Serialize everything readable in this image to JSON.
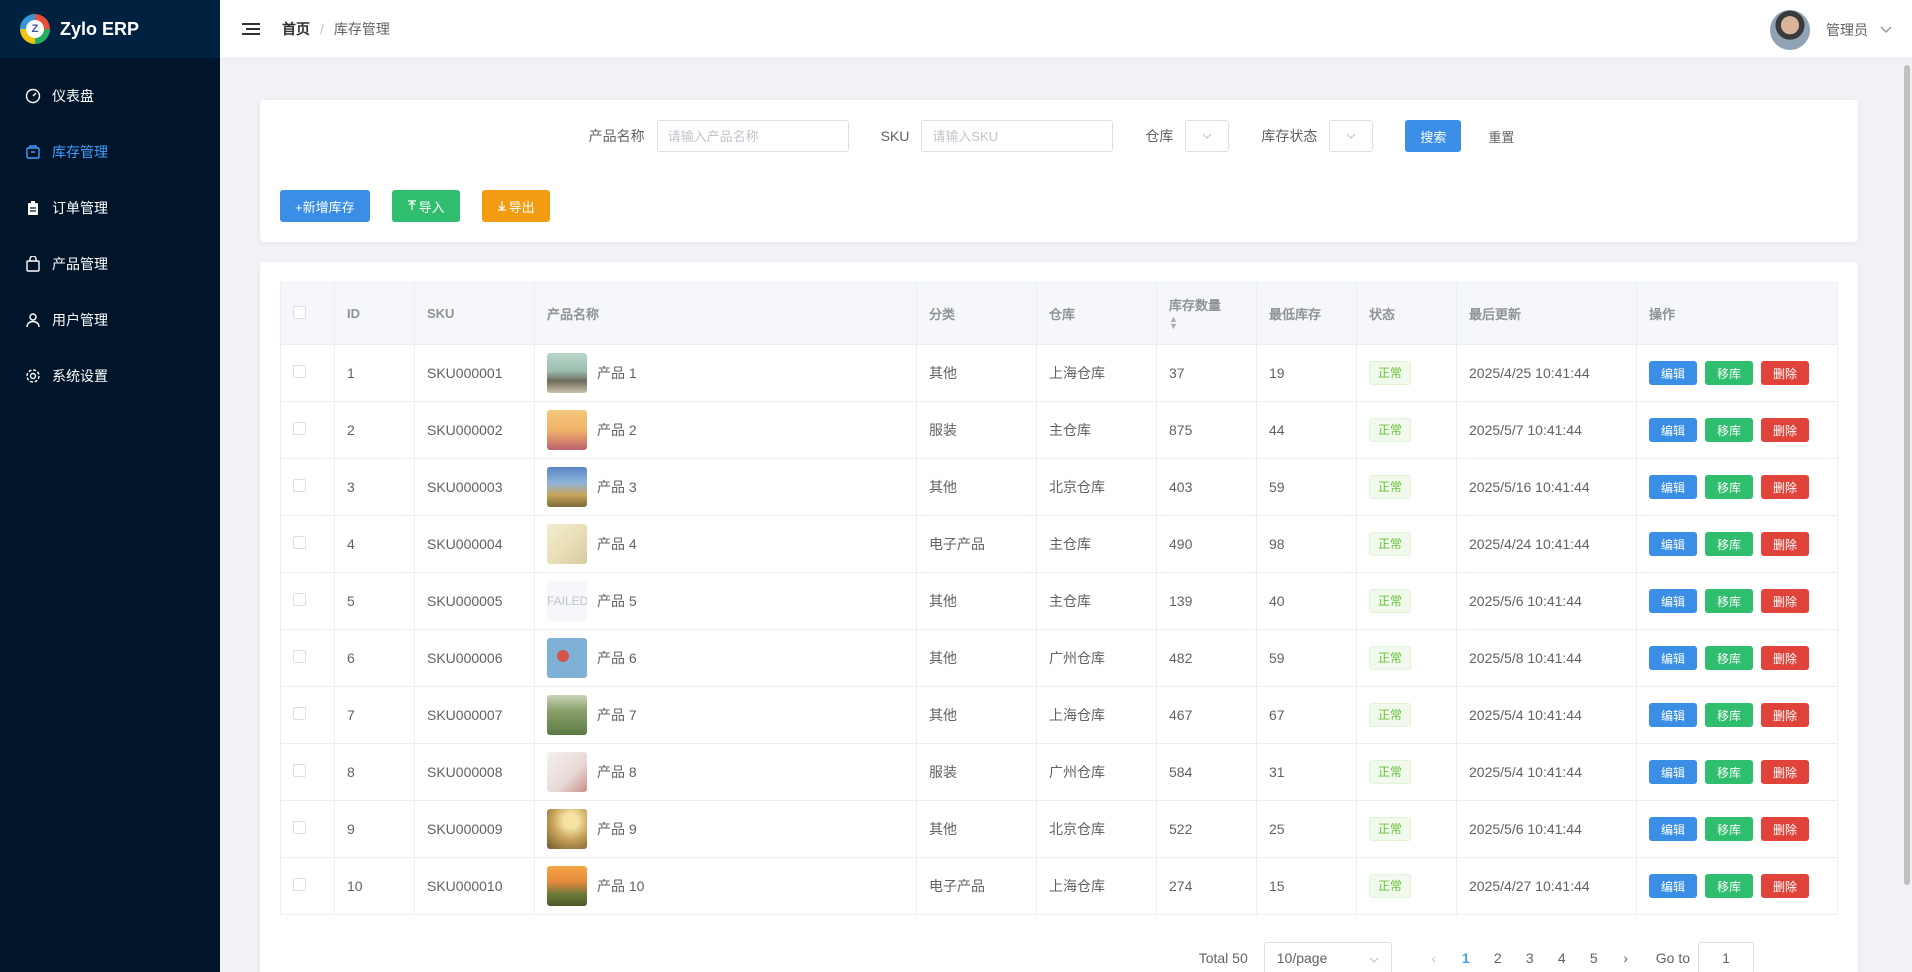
{
  "app": {
    "name": "Zylo ERP",
    "logo_letter": "Z"
  },
  "sidebar": {
    "items": [
      {
        "label": "仪表盘",
        "icon": "dashboard-icon",
        "active": false
      },
      {
        "label": "库存管理",
        "icon": "box-icon",
        "active": true
      },
      {
        "label": "订单管理",
        "icon": "clipboard-icon",
        "active": false
      },
      {
        "label": "产品管理",
        "icon": "bag-icon",
        "active": false
      },
      {
        "label": "用户管理",
        "icon": "user-icon",
        "active": false
      },
      {
        "label": "系统设置",
        "icon": "gear-icon",
        "active": false
      }
    ]
  },
  "header": {
    "breadcrumb": {
      "home": "首页",
      "separator": "/",
      "current": "库存管理"
    },
    "user": {
      "name": "管理员"
    }
  },
  "search": {
    "product_name_label": "产品名称",
    "product_name_placeholder": "请输入产品名称",
    "sku_label": "SKU",
    "sku_placeholder": "请输入SKU",
    "warehouse_label": "仓库",
    "status_label": "库存状态",
    "search_button": "搜索",
    "reset_button": "重置"
  },
  "actions": {
    "add": "+新增库存",
    "import": "导入",
    "export": "导出"
  },
  "table": {
    "headers": {
      "id": "ID",
      "sku": "SKU",
      "product": "产品名称",
      "category": "分类",
      "warehouse": "仓库",
      "quantity": "库存数量",
      "min_stock": "最低库存",
      "status": "状态",
      "updated": "最后更新",
      "ops": "操作"
    },
    "op_labels": {
      "edit": "编辑",
      "move": "移库",
      "delete": "删除"
    },
    "rows": [
      {
        "id": "1",
        "sku": "SKU000001",
        "product": "产品 1",
        "category": "其他",
        "warehouse": "上海仓库",
        "quantity": "37",
        "min_stock": "19",
        "status": "正常",
        "updated": "2025/4/25 10:41:44",
        "thumb": "linear-gradient(180deg,#b9d7c9 0%,#9bbcb0 45%,#6f6a5b 70%,#c9c2ad 100%)"
      },
      {
        "id": "2",
        "sku": "SKU000002",
        "product": "产品 2",
        "category": "服装",
        "warehouse": "主仓库",
        "quantity": "875",
        "min_stock": "44",
        "status": "正常",
        "updated": "2025/5/7 10:41:44",
        "thumb": "linear-gradient(180deg,#f3c77a 0%,#f0b36a 50%,#d98a6a 75%,#b8626e 100%)"
      },
      {
        "id": "3",
        "sku": "SKU000003",
        "product": "产品 3",
        "category": "其他",
        "warehouse": "北京仓库",
        "quantity": "403",
        "min_stock": "59",
        "status": "正常",
        "updated": "2025/5/16 10:41:44",
        "thumb": "linear-gradient(180deg,#5a86c5 0%,#8fb3d9 40%,#c9a55a 70%,#7a6a3a 100%)"
      },
      {
        "id": "4",
        "sku": "SKU000004",
        "product": "产品 4",
        "category": "电子产品",
        "warehouse": "主仓库",
        "quantity": "490",
        "min_stock": "98",
        "status": "正常",
        "updated": "2025/4/24 10:41:44",
        "thumb": "linear-gradient(135deg,#f3ecd0 0%,#e9dfb7 50%,#d6cba0 100%)"
      },
      {
        "id": "5",
        "sku": "SKU000005",
        "product": "产品 5",
        "category": "其他",
        "warehouse": "主仓库",
        "quantity": "139",
        "min_stock": "40",
        "status": "正常",
        "updated": "2025/5/6 10:41:44",
        "thumb": "FAILED"
      },
      {
        "id": "6",
        "sku": "SKU000006",
        "product": "产品 6",
        "category": "其他",
        "warehouse": "广州仓库",
        "quantity": "482",
        "min_stock": "59",
        "status": "正常",
        "updated": "2025/5/8 10:41:44",
        "thumb": "radial-gradient(circle at 40% 45%,#d9534f 0 18%,#7fb1d6 19% 100%)"
      },
      {
        "id": "7",
        "sku": "SKU000007",
        "product": "产品 7",
        "category": "其他",
        "warehouse": "上海仓库",
        "quantity": "467",
        "min_stock": "67",
        "status": "正常",
        "updated": "2025/5/4 10:41:44",
        "thumb": "linear-gradient(180deg,#c9d4b8 0%,#8aa06a 40%,#5e7a44 100%)"
      },
      {
        "id": "8",
        "sku": "SKU000008",
        "product": "产品 8",
        "category": "服装",
        "warehouse": "广州仓库",
        "quantity": "584",
        "min_stock": "31",
        "status": "正常",
        "updated": "2025/5/4 10:41:44",
        "thumb": "linear-gradient(135deg,#f4f1ee 0%,#e8d9d6 60%,#c98f8a 100%)"
      },
      {
        "id": "9",
        "sku": "SKU000009",
        "product": "产品 9",
        "category": "其他",
        "warehouse": "北京仓库",
        "quantity": "522",
        "min_stock": "25",
        "status": "正常",
        "updated": "2025/5/6 10:41:44",
        "thumb": "radial-gradient(circle at 60% 30%,#f6e3a3 0 20%,#c9a35a 50%,#6e5a2e 100%)"
      },
      {
        "id": "10",
        "sku": "SKU000010",
        "product": "产品 10",
        "category": "电子产品",
        "warehouse": "上海仓库",
        "quantity": "274",
        "min_stock": "15",
        "status": "正常",
        "updated": "2025/4/27 10:41:44",
        "thumb": "linear-gradient(180deg,#f4a64a 0%,#e58a3a 40%,#6e7a3a 70%,#4a5a2a 100%)"
      }
    ]
  },
  "pagination": {
    "total": "Total 50",
    "page_size": "10/page",
    "pages": [
      "1",
      "2",
      "3",
      "4",
      "5"
    ],
    "current": "1",
    "goto_label": "Go to",
    "goto_value": "1"
  },
  "colors": {
    "sidebar_bg": "#001529",
    "active": "#409eff",
    "edit": "#3a8ee6",
    "move": "#2fbd6e",
    "delete": "#e0433a"
  }
}
